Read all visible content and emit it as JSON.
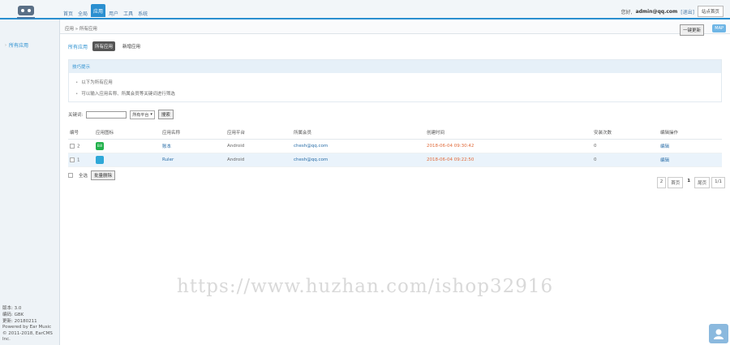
{
  "nav": {
    "items": [
      {
        "label": "首页",
        "active": false
      },
      {
        "label": "全局",
        "active": false
      },
      {
        "label": "应用",
        "active": true
      },
      {
        "label": "用户",
        "active": false
      },
      {
        "label": "工具",
        "active": false
      },
      {
        "label": "系统",
        "active": false
      }
    ]
  },
  "topright": {
    "greeting": "您好,",
    "user": "admin@qq.com",
    "logout": "[退出]",
    "button": "站点首页"
  },
  "sidebar": {
    "item": "所有应用",
    "footer": [
      "版本: 3.0",
      "编码: GBK",
      "更新: 20180211",
      "Powered by Ear Music",
      "© 2011-2018, EarCMS Inc."
    ]
  },
  "crumb": {
    "path": "应用 » 所有应用",
    "button": "一键更新",
    "help": "MAP"
  },
  "tabs": {
    "title": "所有应用",
    "items": [
      {
        "label": "所有应用",
        "active": true
      },
      {
        "label": "新增应用",
        "active": false
      }
    ]
  },
  "tips": {
    "title": "技巧提示",
    "items": [
      "以下为所有应用",
      "可以输入应用名称、所属会员等关键词进行筛选"
    ]
  },
  "search": {
    "label": "关键词:",
    "value": "",
    "select": "所有平台",
    "button": "搜索"
  },
  "table": {
    "headers": [
      "编号",
      "应用图标",
      "应用名称",
      "应用平台",
      "所属会员",
      "创建时间",
      "安装次数",
      "编辑操作"
    ],
    "rows": [
      {
        "id": "2",
        "icon_color": "#22b14c",
        "icon_text": "Bill",
        "name": "账本",
        "platform": "Android",
        "member": "chesh@qq.com",
        "time": "2018-06-04 09:30:42",
        "installs": "0",
        "action": "编辑"
      },
      {
        "id": "1",
        "icon_color": "#2fa8d8",
        "icon_text": "",
        "name": "Ruler",
        "platform": "Android",
        "member": "chesh@qq.com",
        "time": "2018-06-04 09:22:50",
        "installs": "0",
        "action": "编辑"
      }
    ]
  },
  "actions": {
    "select_all": "全选",
    "batch_delete": "批量删除"
  },
  "pager": {
    "items": [
      "2",
      "首页",
      "1",
      "尾页",
      "1/1"
    ]
  },
  "watermark": "https://www.huzhan.com/ishop32916"
}
